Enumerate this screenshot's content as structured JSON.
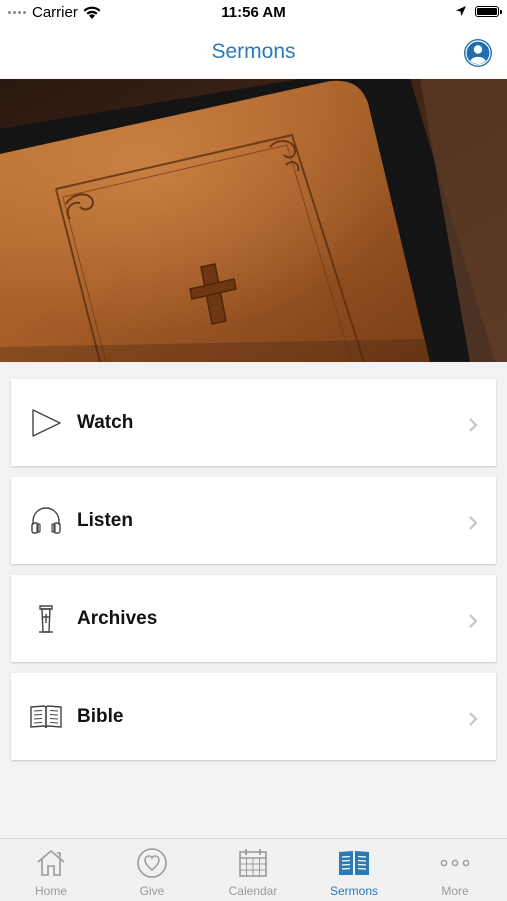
{
  "status_bar": {
    "carrier": "Carrier",
    "time": "11:56 AM"
  },
  "nav": {
    "title": "Sermons"
  },
  "menu_items": [
    {
      "label": "Watch",
      "icon": "play-icon"
    },
    {
      "label": "Listen",
      "icon": "headphones-icon"
    },
    {
      "label": "Archives",
      "icon": "pulpit-icon"
    },
    {
      "label": "Bible",
      "icon": "open-book-icon"
    }
  ],
  "tabs": [
    {
      "label": "Home",
      "icon": "house-icon"
    },
    {
      "label": "Give",
      "icon": "heart-icon"
    },
    {
      "label": "Calendar",
      "icon": "calendar-icon"
    },
    {
      "label": "Sermons",
      "icon": "book-icon",
      "active": true
    },
    {
      "label": "More",
      "icon": "ellipsis-icon"
    }
  ],
  "colors": {
    "accent": "#2a7ab8",
    "inactive_tab": "#999999",
    "background": "#f2f2f4"
  }
}
